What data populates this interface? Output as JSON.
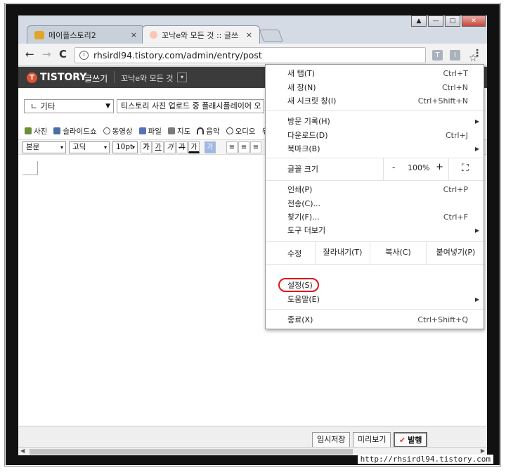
{
  "tabs": [
    {
      "title": "메이플스토리2",
      "close": "×"
    },
    {
      "title": "꼬낙e와 모든 것 :: 글쓰",
      "close": "×"
    }
  ],
  "window_controls": {
    "user": "▲",
    "minimize": "—",
    "maximize": "□",
    "close": "✕"
  },
  "toolbar": {
    "back": "←",
    "forward": "→",
    "reload": "C",
    "url": "rhsirdl94.tistory.com/admin/entry/post",
    "info_icon": "i",
    "star": "☆",
    "ext1": "T",
    "ext2": "I",
    "menu": "⋮"
  },
  "tistory": {
    "logo": "TISTORY",
    "logo_mark": "T",
    "write_label": "글쓰기",
    "blog_name": "꼬낙e와 모든 것",
    "blog_caret": "▾"
  },
  "editor": {
    "category": "ㄴ 기타",
    "category_caret": "▼",
    "title_value": "티스토리 사진 업로드 중 플래시플레이어 오",
    "insert_items": [
      "사진",
      "슬라이드쇼",
      "동영상",
      "파일",
      "지도",
      "음악",
      "오디오",
      "위"
    ],
    "format": {
      "paragraph": "본문",
      "font": "고딕",
      "size": "10pt",
      "caret": "▾",
      "buttons": [
        "가",
        "가",
        "가",
        "가",
        "가",
        "가",
        "≡",
        "≡",
        "≡"
      ]
    },
    "bottom_buttons": {
      "temp_save": "임시저장",
      "preview": "미리보기",
      "publish": "발행",
      "check": "✔"
    }
  },
  "menu": {
    "items_top": [
      {
        "label": "새 탭(T)",
        "shortcut": "Ctrl+T"
      },
      {
        "label": "새 창(N)",
        "shortcut": "Ctrl+N"
      },
      {
        "label": "새 시크릿 창(I)",
        "shortcut": "Ctrl+Shift+N"
      }
    ],
    "items_history": [
      {
        "label": "방문 기록(H)",
        "shortcut": "",
        "sub": "▶"
      },
      {
        "label": "다운로드(D)",
        "shortcut": "Ctrl+J"
      },
      {
        "label": "북마크(B)",
        "shortcut": "",
        "sub": "▶"
      }
    ],
    "zoom": {
      "label": "글꼴 크기",
      "minus": "-",
      "value": "100%",
      "plus": "+",
      "fullscreen": "⛶"
    },
    "items_tools": [
      {
        "label": "인쇄(P)",
        "shortcut": "Ctrl+P"
      },
      {
        "label": "전송(C)...",
        "shortcut": ""
      },
      {
        "label": "찾기(F)...",
        "shortcut": "Ctrl+F"
      },
      {
        "label": "도구 더보기",
        "shortcut": "",
        "sub": "▶"
      }
    ],
    "edit": {
      "label": "수정",
      "cut": "잘라내기(T)",
      "copy": "복사(C)",
      "paste": "붙여넣기(P)"
    },
    "items_settings": [
      {
        "label": "설정(S)",
        "shortcut": ""
      },
      {
        "label": "도움말(E)",
        "shortcut": "",
        "sub": "▶"
      }
    ],
    "exit": {
      "label": "종료(X)",
      "shortcut": "Ctrl+Shift+Q"
    }
  },
  "watermark": "http://rhsirdl94.tistory.com",
  "colors": {
    "tistory_bar": "#3b3b3b",
    "tistory_accent": "#e05436",
    "highlight": "#e01515",
    "publish_check": "#e03a2e"
  }
}
